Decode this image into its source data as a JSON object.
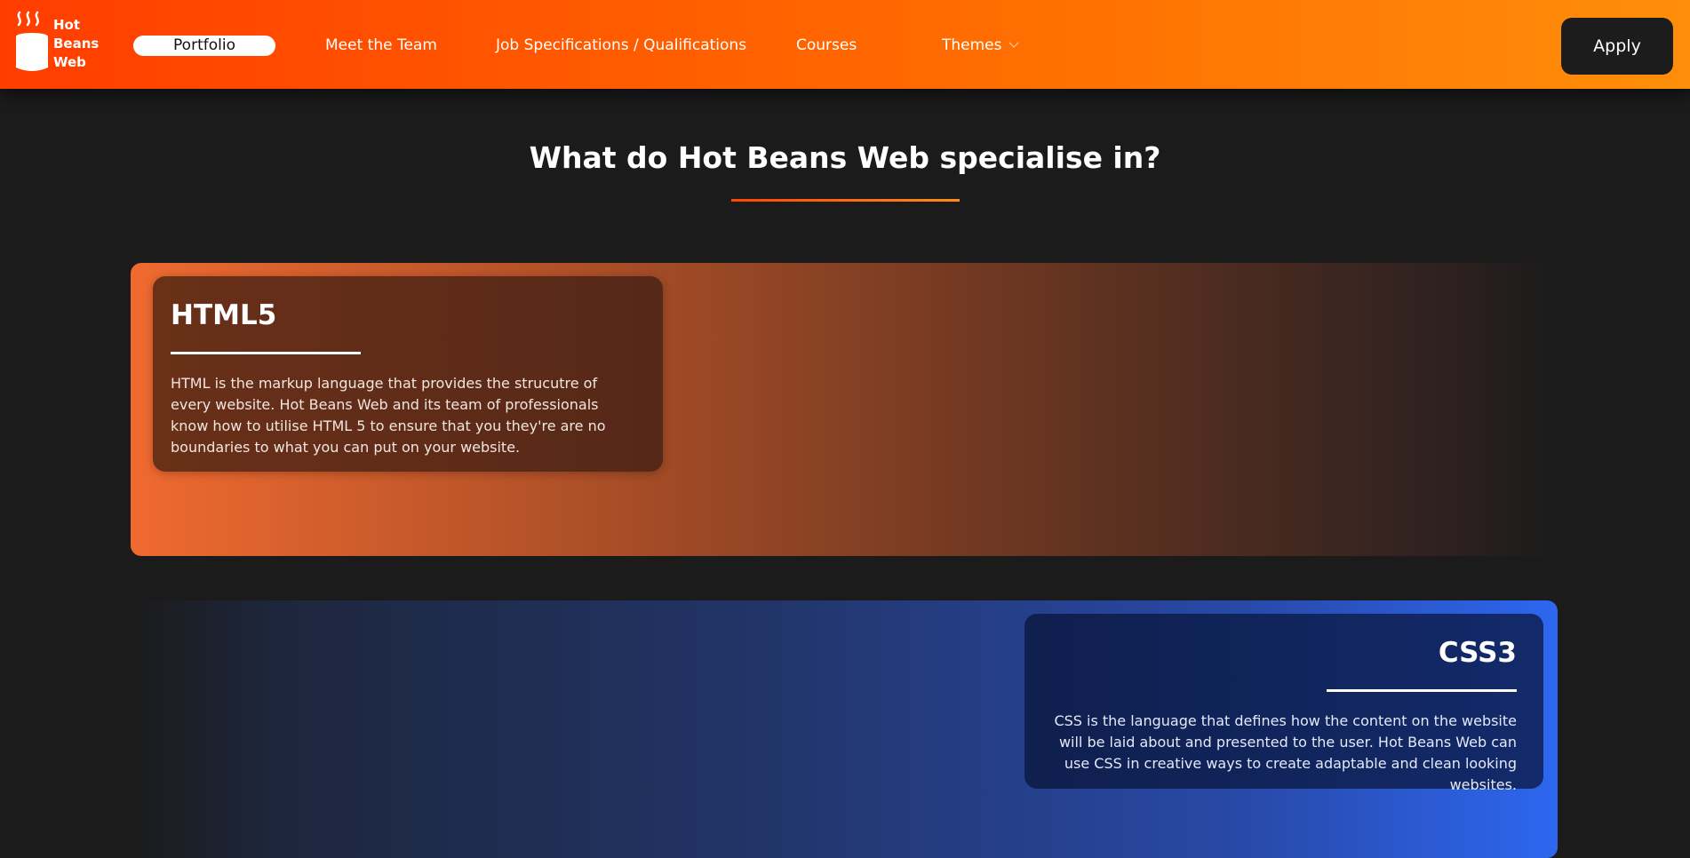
{
  "brand": {
    "name_lines": [
      "Hot",
      "Beans",
      "Web"
    ],
    "logo_icon": "coffee-cup-icon"
  },
  "nav": {
    "items": [
      {
        "label": "Portfolio",
        "active": true
      },
      {
        "label": "Meet the Team"
      },
      {
        "label": "Job Specifications / Qualifications"
      },
      {
        "label": "Courses"
      },
      {
        "label": "Themes",
        "icon": "chevron-down-icon"
      }
    ]
  },
  "header": {
    "apply_label": "Apply",
    "gradient": [
      "#ff3d00",
      "#ff6a00",
      "#ff8e0a"
    ]
  },
  "section": {
    "title": "What do Hot Beans Web specialise in?"
  },
  "features": [
    {
      "title": "HTML5",
      "text": "HTML is the markup language that provides the strucutre of every website. Hot Beans Web and its team of professionals know how to utilise HTML 5 to ensure that you they're are no boundaries to what you can put on your website.",
      "accent": "#f06a30"
    },
    {
      "title": "CSS3",
      "text": "CSS is the language that defines how the content on the website will be laid about and presented to the user. Hot Beans Web can use CSS in creative ways to create adaptable and clean looking websites.",
      "accent": "#2d66f0"
    }
  ],
  "colors": {
    "page_background": "#1b1b1b",
    "apply_button": "#1c1c1c"
  }
}
